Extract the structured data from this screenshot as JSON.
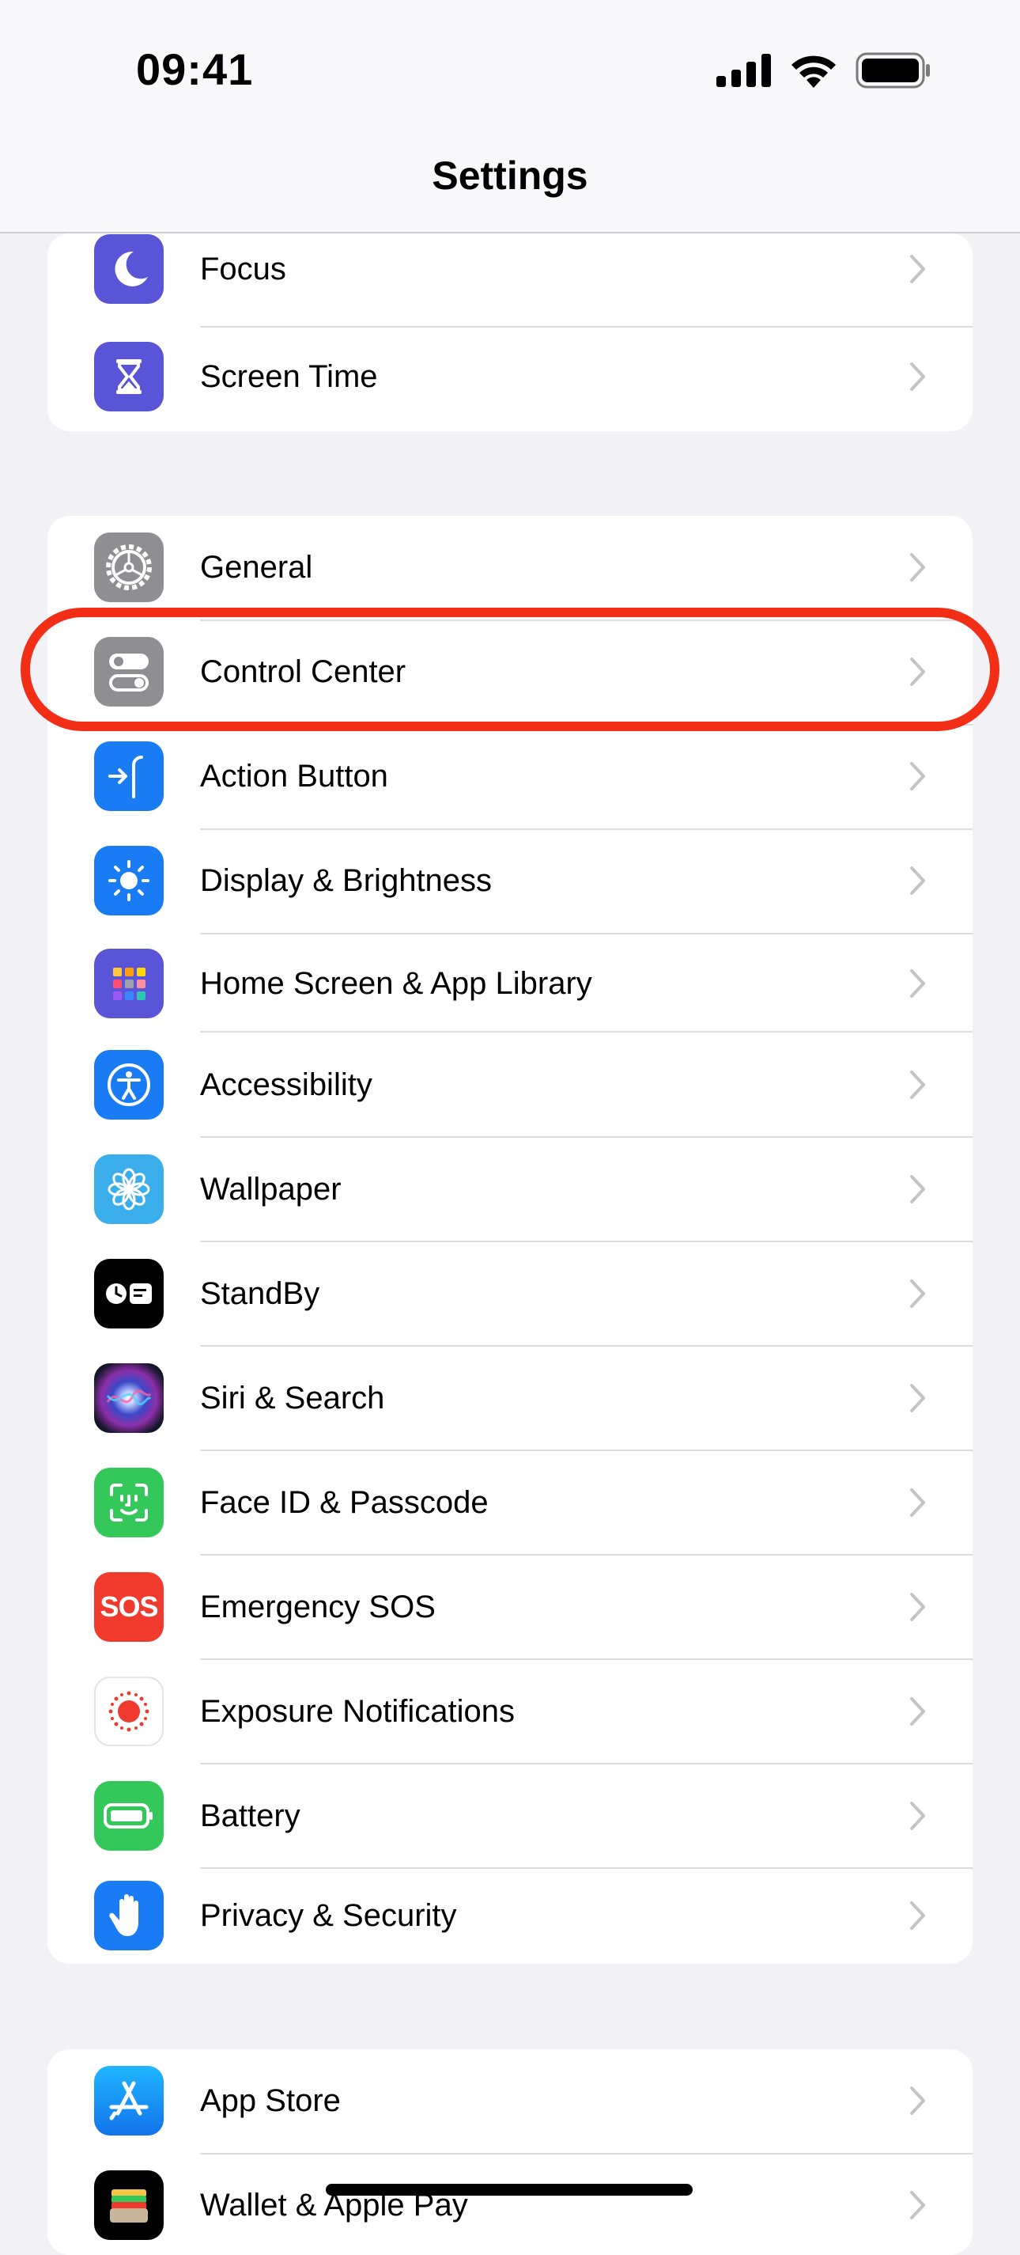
{
  "status_bar": {
    "time": "09:41"
  },
  "nav": {
    "title": "Settings"
  },
  "colors": {
    "purple": "#5A55D6",
    "gray": "#8E8E93",
    "blue": "#1A7CF5",
    "green": "#34C759",
    "red": "#F03A2E",
    "highlight": "#F22E17"
  },
  "groups": [
    {
      "items": [
        {
          "label": "Focus",
          "icon": "moon-icon"
        },
        {
          "label": "Screen Time",
          "icon": "hourglass-icon"
        }
      ]
    },
    {
      "items": [
        {
          "label": "General",
          "icon": "gear-icon"
        },
        {
          "label": "Control Center",
          "icon": "toggles-icon",
          "highlighted": true
        },
        {
          "label": "Action Button",
          "icon": "action-button-icon"
        },
        {
          "label": "Display & Brightness",
          "icon": "sun-icon"
        },
        {
          "label": "Home Screen & App Library",
          "icon": "app-grid-icon"
        },
        {
          "label": "Accessibility",
          "icon": "accessibility-icon"
        },
        {
          "label": "Wallpaper",
          "icon": "flower-icon"
        },
        {
          "label": "StandBy",
          "icon": "standby-icon"
        },
        {
          "label": "Siri & Search",
          "icon": "siri-icon"
        },
        {
          "label": "Face ID & Passcode",
          "icon": "face-id-icon"
        },
        {
          "label": "Emergency SOS",
          "icon": "sos-icon",
          "icon_text": "SOS"
        },
        {
          "label": "Exposure Notifications",
          "icon": "exposure-icon"
        },
        {
          "label": "Battery",
          "icon": "battery-icon"
        },
        {
          "label": "Privacy & Security",
          "icon": "hand-icon"
        }
      ]
    },
    {
      "items": [
        {
          "label": "App Store",
          "icon": "app-store-icon"
        },
        {
          "label": "Wallet & Apple Pay",
          "icon": "wallet-icon"
        }
      ]
    }
  ]
}
